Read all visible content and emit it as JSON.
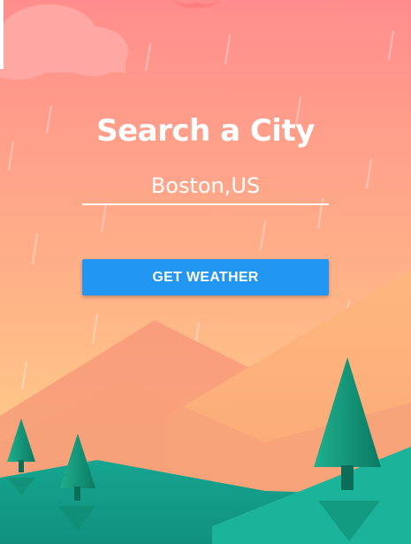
{
  "search": {
    "title": "Search a City",
    "city_value": "Boston,US",
    "button_label": "GET WEATHER"
  },
  "colors": {
    "accent": "#2196f3",
    "sky_top": "#ff8f8c",
    "sky_bottom": "#ffd08a",
    "mountain": "#f7a37a",
    "hill": "#1aa891",
    "tree": "#0f8c72"
  },
  "icons": [
    "cloud-icon",
    "bird-icon",
    "tree-icon"
  ]
}
